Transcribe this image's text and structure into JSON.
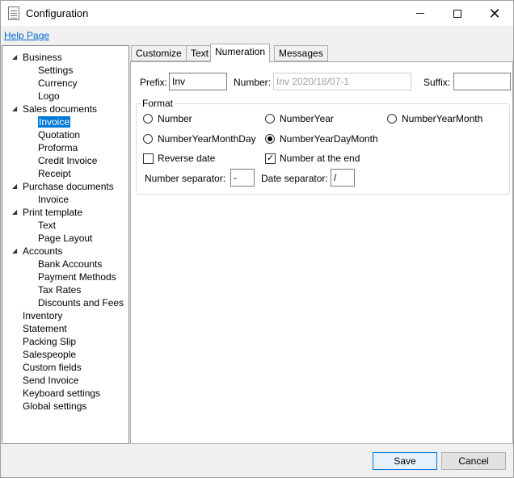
{
  "window": {
    "title": "Configuration",
    "minimize_glyph": "",
    "close_glyph": "✕"
  },
  "help_link": "Help Page",
  "tree": {
    "items": [
      {
        "label": "Business",
        "expandable": true
      },
      {
        "label": "Settings"
      },
      {
        "label": "Currency"
      },
      {
        "label": "Logo"
      },
      {
        "label": "Sales documents",
        "expandable": true
      },
      {
        "label": "Invoice",
        "selected": true
      },
      {
        "label": "Quotation"
      },
      {
        "label": "Proforma"
      },
      {
        "label": "Credit Invoice"
      },
      {
        "label": "Receipt"
      },
      {
        "label": "Purchase documents",
        "expandable": true
      },
      {
        "label": "Invoice"
      },
      {
        "label": "Print template",
        "expandable": true
      },
      {
        "label": "Text"
      },
      {
        "label": "Page Layout"
      },
      {
        "label": "Accounts",
        "expandable": true
      },
      {
        "label": "Bank Accounts"
      },
      {
        "label": "Payment Methods"
      },
      {
        "label": "Tax Rates"
      },
      {
        "label": "Discounts and Fees"
      },
      {
        "label": "Inventory"
      },
      {
        "label": "Statement"
      },
      {
        "label": "Packing Slip"
      },
      {
        "label": "Salespeople"
      },
      {
        "label": "Custom fields"
      },
      {
        "label": "Send Invoice"
      },
      {
        "label": "Keyboard settings"
      },
      {
        "label": "Global settings"
      }
    ],
    "expander_glyph": "◢"
  },
  "tabs": [
    {
      "label": "Customize"
    },
    {
      "label": "Text"
    },
    {
      "label": "Numeration",
      "active": true
    },
    {
      "label": "Messages"
    }
  ],
  "numeration": {
    "prefix_label": "Prefix:",
    "prefix_value": "Inv",
    "number_label": "Number:",
    "number_value": "Inv 2020/18/07-1",
    "suffix_label": "Suffix:",
    "suffix_value": "",
    "format_title": "Format",
    "radios": [
      {
        "label": "Number",
        "checked": false
      },
      {
        "label": "NumberYear",
        "checked": false
      },
      {
        "label": "NumberYearMonth",
        "checked": false
      },
      {
        "label": "NumberYearMonthDay",
        "checked": false
      },
      {
        "label": "NumberYearDayMonth",
        "checked": true
      }
    ],
    "reverse_date_label": "Reverse date",
    "reverse_date_checked": false,
    "number_at_end_label": "Number at the end",
    "number_at_end_checked": true,
    "checkmark_glyph": "✓",
    "number_separator_label": "Number separator:",
    "number_separator_value": "-",
    "date_separator_label": "Date separator:",
    "date_separator_value": "/"
  },
  "buttons": {
    "save": "Save",
    "cancel": "Cancel"
  },
  "colors": {
    "selection": "#0078d7",
    "link": "#0066cc",
    "default_button_border": "#0078d7"
  }
}
